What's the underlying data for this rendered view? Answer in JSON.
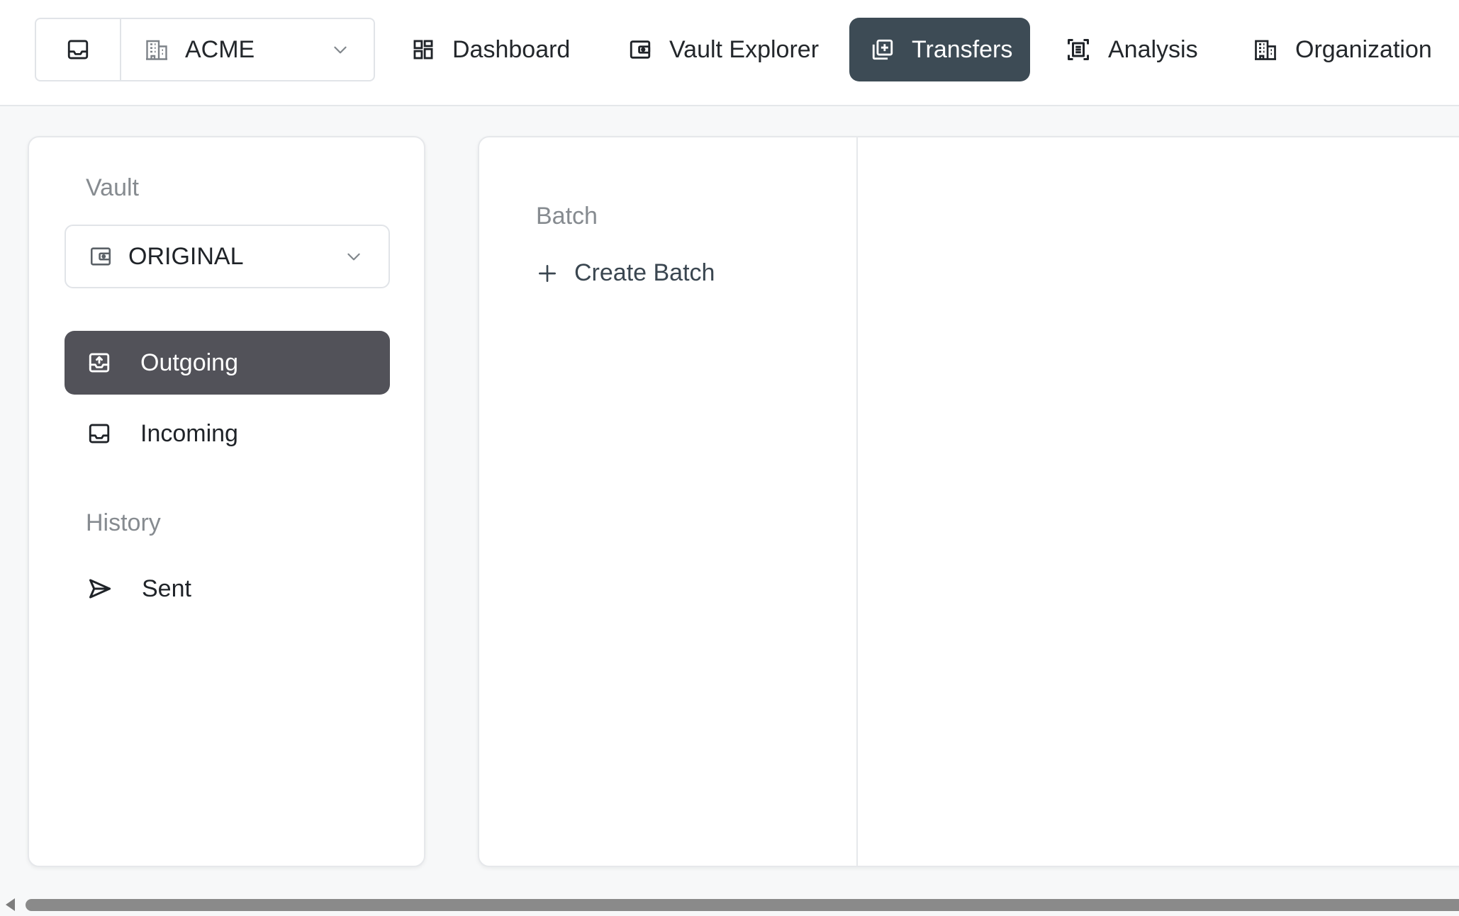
{
  "topbar": {
    "inbox_icon": "inbox-icon",
    "org_select": {
      "icon": "building-icon",
      "value": "ACME"
    },
    "nav": [
      {
        "label": "Dashboard",
        "icon": "dashboard-grid-icon",
        "active": false
      },
      {
        "label": "Vault Explorer",
        "icon": "wallet-icon",
        "active": false
      },
      {
        "label": "Transfers",
        "icon": "copy-plus-icon",
        "active": true
      },
      {
        "label": "Analysis",
        "icon": "scan-text-icon",
        "active": false
      },
      {
        "label": "Organization",
        "icon": "building-icon",
        "active": false
      }
    ]
  },
  "sidebar": {
    "vault_label": "Vault",
    "vault_select": {
      "icon": "wallet-icon",
      "value": "ORIGINAL"
    },
    "items": [
      {
        "label": "Outgoing",
        "icon": "inbox-upload-icon",
        "active": true
      },
      {
        "label": "Incoming",
        "icon": "inbox-icon",
        "active": false
      }
    ],
    "history_label": "History",
    "history_items": [
      {
        "label": "Sent",
        "icon": "send-icon",
        "active": false
      }
    ]
  },
  "main": {
    "batch_label": "Batch",
    "create_batch_label": "Create Batch"
  },
  "colors": {
    "active_nav": "#3d4b55",
    "active_sidebar": "#525259",
    "page_bg": "#f7f8f9"
  }
}
